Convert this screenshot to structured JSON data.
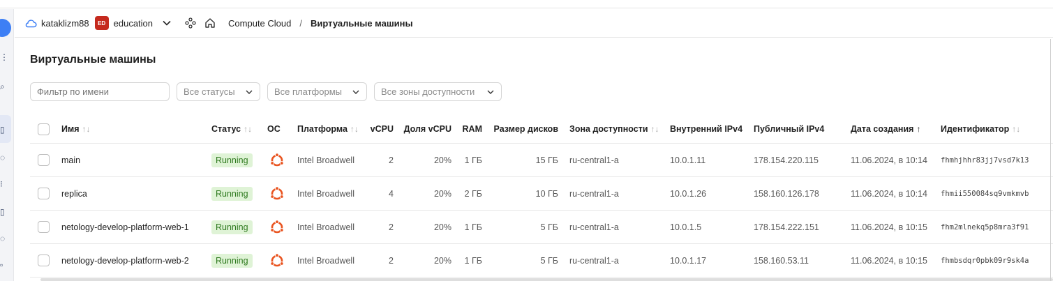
{
  "header": {
    "account": "kataklizm88",
    "folder_badge": "ED",
    "folder": "education",
    "breadcrumb_service": "Compute Cloud",
    "breadcrumb_separator": "/",
    "breadcrumb_current": "Виртуальные машины"
  },
  "page": {
    "title": "Виртуальные машины"
  },
  "filters": {
    "name_placeholder": "Фильтр по имени",
    "status": "Все статусы",
    "platform": "Все платформы",
    "zone": "Все зоны доступности"
  },
  "columns": {
    "name": "Имя",
    "status": "Статус",
    "os": "ОС",
    "platform": "Платформа",
    "vcpu": "vCPU",
    "vcpu_share": "Доля vCPU",
    "ram": "RAM",
    "disks": "Размер дисков",
    "zone": "Зона доступности",
    "internal_ip": "Внутренний IPv4",
    "public_ip": "Публичный IPv4",
    "created": "Дата создания",
    "id": "Идентификатор"
  },
  "sort_glyphs": {
    "neutral": "↑↓",
    "active": "↑"
  },
  "rows": [
    {
      "name": "main",
      "status": "Running",
      "platform": "Intel Broadwell",
      "vcpu": "2",
      "vcpu_share": "20%",
      "ram": "1 ГБ",
      "disks": "15 ГБ",
      "zone": "ru-central1-a",
      "internal_ip": "10.0.1.11",
      "public_ip": "178.154.220.115",
      "created": "11.06.2024, в 10:14",
      "id": "fhmhjhhr83jj7vsd7k13"
    },
    {
      "name": "replica",
      "status": "Running",
      "platform": "Intel Broadwell",
      "vcpu": "4",
      "vcpu_share": "20%",
      "ram": "2 ГБ",
      "disks": "10 ГБ",
      "zone": "ru-central1-a",
      "internal_ip": "10.0.1.26",
      "public_ip": "158.160.126.178",
      "created": "11.06.2024, в 10:14",
      "id": "fhmii550084sq9vmkmvb"
    },
    {
      "name": "netology-develop-platform-web-1",
      "status": "Running",
      "platform": "Intel Broadwell",
      "vcpu": "2",
      "vcpu_share": "20%",
      "ram": "1 ГБ",
      "disks": "5 ГБ",
      "zone": "ru-central1-a",
      "internal_ip": "10.0.1.5",
      "public_ip": "178.154.222.151",
      "created": "11.06.2024, в 10:15",
      "id": "fhm2mlnekq5p8mra3f91"
    },
    {
      "name": "netology-develop-platform-web-2",
      "status": "Running",
      "platform": "Intel Broadwell",
      "vcpu": "2",
      "vcpu_share": "20%",
      "ram": "1 ГБ",
      "disks": "5 ГБ",
      "zone": "ru-central1-a",
      "internal_ip": "10.0.1.17",
      "public_ip": "158.160.53.11",
      "created": "11.06.2024, в 10:15",
      "id": "fhmbsdqr0pbk09r9sk4a"
    }
  ],
  "colors": {
    "status_bg": "#dff3d6",
    "status_fg": "#2f7a1f",
    "ubuntu": "#e95420",
    "folder_badge": "#c52a1e"
  },
  "icons": {
    "os": "ubuntu-icon"
  }
}
